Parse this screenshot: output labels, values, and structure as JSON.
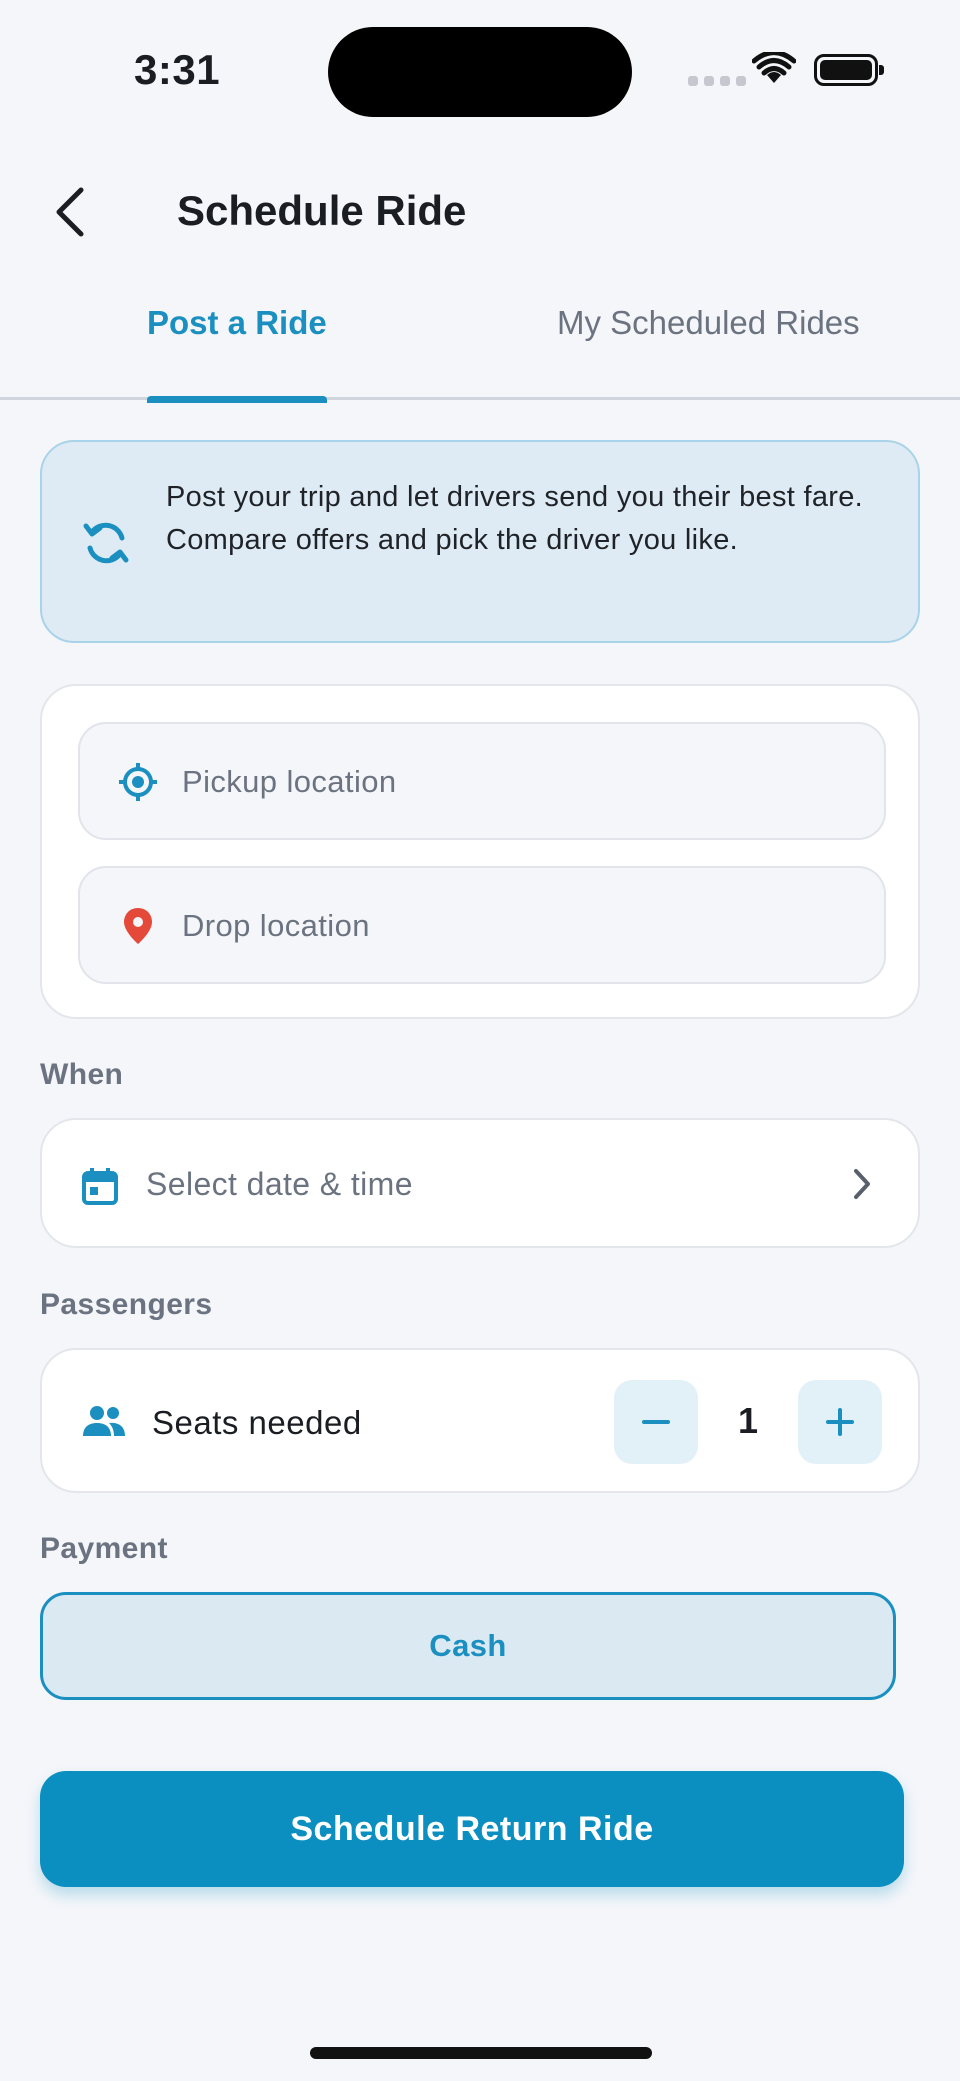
{
  "status_bar": {
    "time": "3:31"
  },
  "header": {
    "title": "Schedule Ride",
    "tabs": [
      {
        "label": "Post a Ride",
        "active": true
      },
      {
        "label": "My Scheduled Rides",
        "active": false
      }
    ]
  },
  "info_banner": {
    "text": "Post your trip and let drivers send you their best fare. Compare offers and pick the driver you like.",
    "icon": "sync-icon"
  },
  "locations": {
    "pickup": {
      "placeholder": "Pickup location",
      "value": "",
      "icon": "gps-target-icon"
    },
    "drop": {
      "placeholder": "Drop location",
      "value": "",
      "icon": "map-pin-icon"
    }
  },
  "when": {
    "label": "When",
    "placeholder": "Select date & time",
    "icon": "calendar-icon"
  },
  "passengers": {
    "label": "Passengers",
    "seats_label": "Seats needed",
    "count": "1",
    "icon": "people-icon"
  },
  "payment": {
    "label": "Payment",
    "selected": "Cash"
  },
  "primary_action": {
    "label": "Schedule Return Ride"
  },
  "colors": {
    "accent": "#1a8fc0",
    "primary_button": "#0b8ec0",
    "background": "#f4f6fa",
    "drop_pin": "#e5493a"
  }
}
